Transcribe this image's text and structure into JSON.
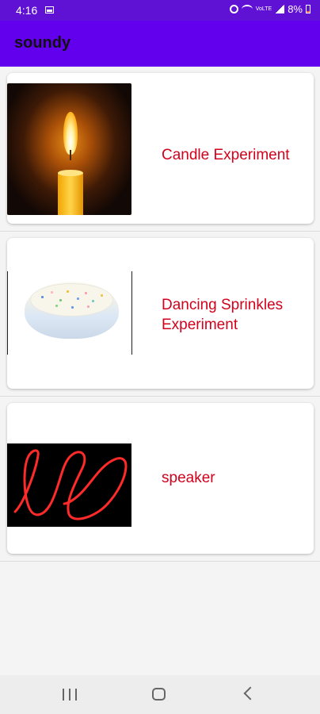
{
  "status_bar": {
    "time": "4:16",
    "battery_percent": "8%",
    "network_label": "VoLTE"
  },
  "app": {
    "title": "soundy",
    "accent_color": "#6200ee",
    "label_color": "#d1021c"
  },
  "list": {
    "items": [
      {
        "label": "Candle Experiment",
        "icon": "candle-image"
      },
      {
        "label": "Dancing Sprinkles Experiment",
        "icon": "sprinkles-bowl-image"
      },
      {
        "label": "speaker",
        "icon": "speaker-light-image"
      }
    ]
  },
  "navigation": {
    "recent_icon": "recent-apps-icon",
    "home_icon": "home-icon",
    "back_icon": "back-icon"
  }
}
